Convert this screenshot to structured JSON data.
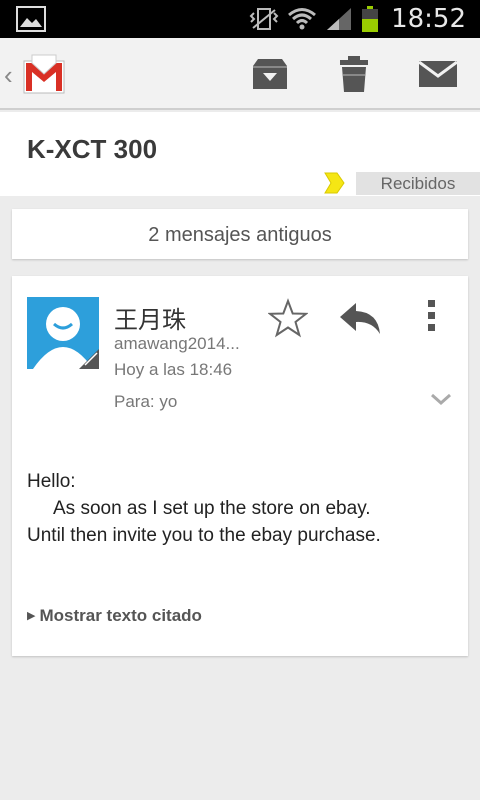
{
  "status_bar": {
    "time": "18:52"
  },
  "action_bar": {
    "back_glyph": "‹",
    "logo_icon": "gmail-logo-icon",
    "buttons": [
      "archive-icon",
      "delete-icon",
      "mark-unread-icon"
    ]
  },
  "conversation": {
    "subject": "K-XCT 300",
    "label": "Recibidos",
    "label_color": "#f5e614",
    "older_messages": "2 mensajes antiguos"
  },
  "message": {
    "sender": "王月珠",
    "email": "amawang2014...",
    "time": "Hoy a las 18:46",
    "recipient": "Para: yo",
    "avatar_color": "#2d9fdb",
    "body": {
      "line1": "Hello:",
      "line2": "As soon as I set up the store on ebay.",
      "line3": "Until then invite you to the ebay purchase."
    },
    "show_quoted": "Mostrar texto citado"
  }
}
